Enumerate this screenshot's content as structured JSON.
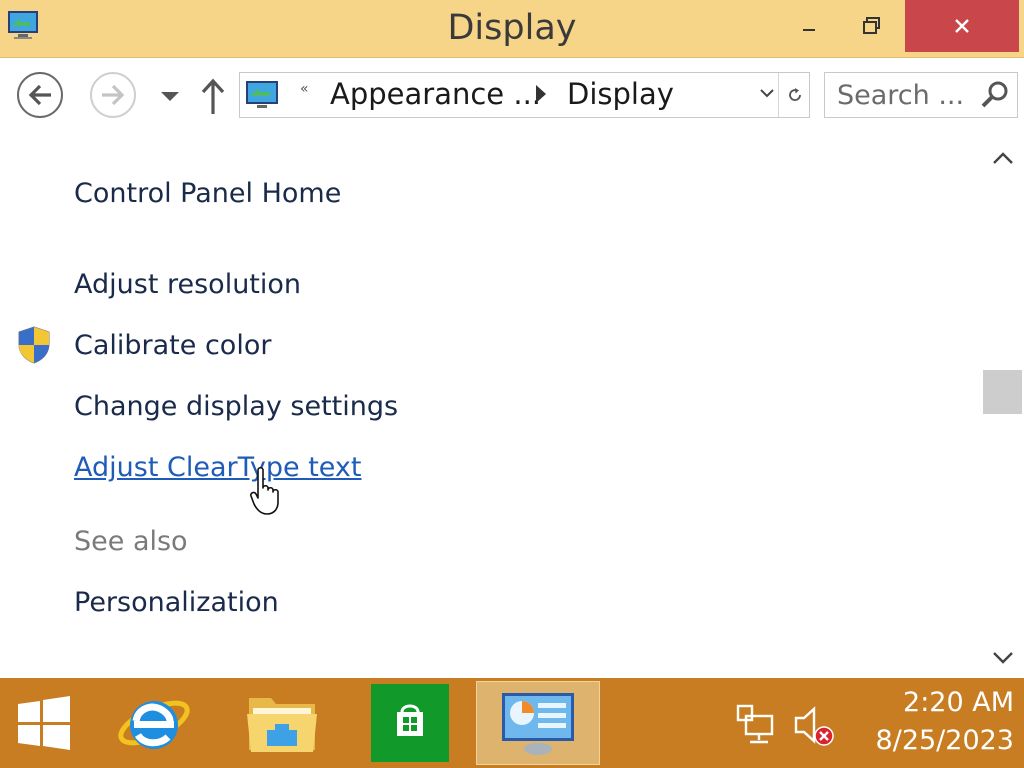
{
  "window": {
    "title": "Display",
    "icon": "display-control-panel-icon",
    "controls": {
      "minimize": "minimize-icon",
      "maximize": "maximize-icon",
      "close": "close-icon"
    }
  },
  "navigation": {
    "back_icon": "arrow-left-icon",
    "forward_icon": "arrow-right-icon",
    "recent_icon": "chevron-down-icon",
    "up_icon": "arrow-up-icon",
    "address": {
      "overflow_chevron": "«",
      "segments": [
        "Appearance ...",
        "Display"
      ]
    },
    "search": {
      "placeholder": "Search ..."
    }
  },
  "sidebar": {
    "home_link": "Control Panel Home",
    "tasks": [
      {
        "label": "Adjust resolution",
        "shield": false
      },
      {
        "label": "Calibrate color",
        "shield": true
      },
      {
        "label": "Change display settings",
        "shield": false
      },
      {
        "label": "Adjust ClearType text",
        "shield": false,
        "hovered": true
      }
    ],
    "see_also_heading": "See also",
    "see_also": [
      "Personalization"
    ]
  },
  "scrollbar": {
    "up_icon": "chevron-up-icon",
    "down_icon": "chevron-down-icon"
  },
  "taskbar": {
    "items": [
      "start-button",
      "internet-explorer",
      "file-explorer",
      "store",
      "display-control-panel"
    ],
    "active_item": "display-control-panel",
    "tray": {
      "network_icon": "network-icon",
      "volume_icon": "volume-muted-icon"
    },
    "clock": {
      "time": "2:20 AM",
      "date": "8/25/2023"
    }
  },
  "colors": {
    "titlebar": "#f6d589",
    "close_button": "#c9474a",
    "taskbar": "#c97d22",
    "link_hover": "#1f5bb8",
    "link": "#1a2a4a"
  }
}
